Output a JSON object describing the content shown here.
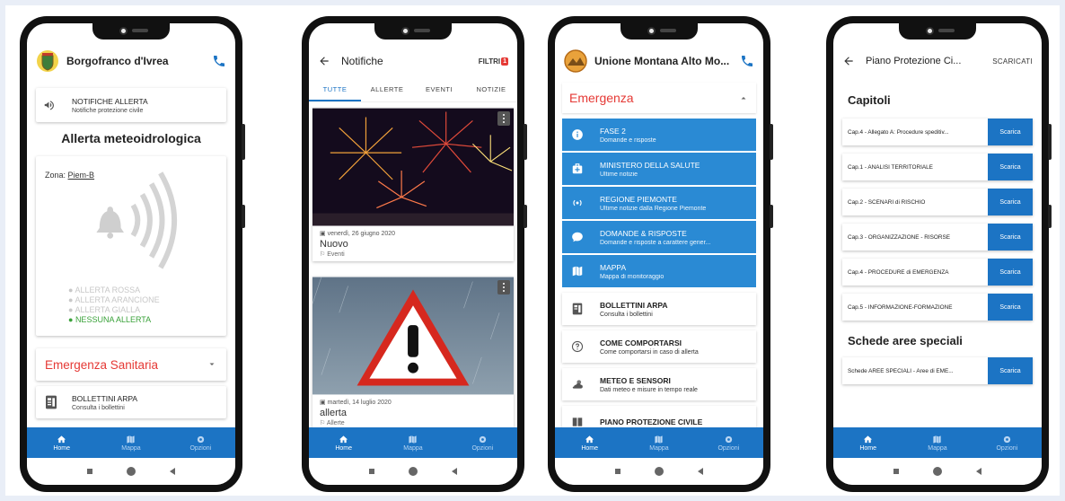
{
  "phone1": {
    "title": "Borgofranco d'Ivrea",
    "notif_title": "NOTIFICHE ALLERTA",
    "notif_sub": "Notifiche protezione civile",
    "heading": "Allerta meteoidrologica",
    "zone_label": "Zona:",
    "zone_value": "Piem-B",
    "legend": [
      "ALLERTA ROSSA",
      "ALLERTA ARANCIONE",
      "ALLERTA GIALLA",
      "NESSUNA ALLERTA"
    ],
    "sanitaria": "Emergenza Sanitaria",
    "bollettini_title": "BOLLETTINI ARPA",
    "bollettini_sub": "Consulta i bollettini"
  },
  "phone2": {
    "title": "Notifiche",
    "filtri": "FILTRI",
    "filtri_badge": "1",
    "tabs": [
      "TUTTE",
      "ALLERTE",
      "EVENTI",
      "NOTIZIE"
    ],
    "cards": [
      {
        "date": "venerdì, 26 giugno 2020",
        "title": "Nuovo",
        "tag": "Eventi"
      },
      {
        "date": "martedì, 14 luglio 2020",
        "title": "allerta",
        "tag": "Allerte"
      }
    ]
  },
  "phone3": {
    "title": "Unione Montana Alto Mo...",
    "section": "Emergenza",
    "blue_items": [
      {
        "icon": "info-icon",
        "title": "FASE 2",
        "sub": "Domande e risposte"
      },
      {
        "icon": "medical-kit-icon",
        "title": "MINISTERO DELLA SALUTE",
        "sub": "Ultime notizie"
      },
      {
        "icon": "broadcast-icon",
        "title": "REGIONE PIEMONTE",
        "sub": "Ultime notizie dalla Regione Piemonte"
      },
      {
        "icon": "chat-bubble-icon",
        "title": "DOMANDE & RISPOSTE",
        "sub": "Domande e risposte a carattere gener..."
      },
      {
        "icon": "map-icon",
        "title": "MAPPA",
        "sub": "Mappa di monitoraggio"
      }
    ],
    "white_items": [
      {
        "icon": "document-icon",
        "title": "BOLLETTINI ARPA",
        "sub": "Consulta i bollettini"
      },
      {
        "icon": "help-circle-icon",
        "title": "COME COMPORTARSI",
        "sub": "Come comportarsi in caso di allerta"
      },
      {
        "icon": "weather-icon",
        "title": "METEO E SENSORI",
        "sub": "Dati meteo e misure in tempo reale"
      },
      {
        "icon": "book-icon",
        "title": "PIANO PROTEZIONE CIVILE",
        "sub": ""
      }
    ]
  },
  "phone4": {
    "title": "Piano Protezione Ci...",
    "scaricati": "SCARICATI",
    "capitoli": "Capitoli",
    "chapters": [
      "Cap.4 - Allegato A: Procedure speditiv...",
      "Cap.1 - ANALISI TERRITORIALE",
      "Cap.2 - SCENARI di RISCHIO",
      "Cap.3 - ORGANIZZAZIONE - RISORSE",
      "Cap.4 - PROCEDURE di EMERGENZA",
      "Cap.5 - INFORMAZIONE-FORMAZIONE"
    ],
    "schede_title": "Schede aree speciali",
    "schede": [
      "Schede AREE SPECIALI - Aree di EME..."
    ],
    "button": "Scarica"
  },
  "nav": {
    "home": "Home",
    "mappa": "Mappa",
    "opzioni": "Opzioni"
  },
  "colors": {
    "primary": "#1c74c4",
    "emergency": "#e53935",
    "ok": "#3aa23a",
    "list_blue": "#2a8ad4"
  }
}
